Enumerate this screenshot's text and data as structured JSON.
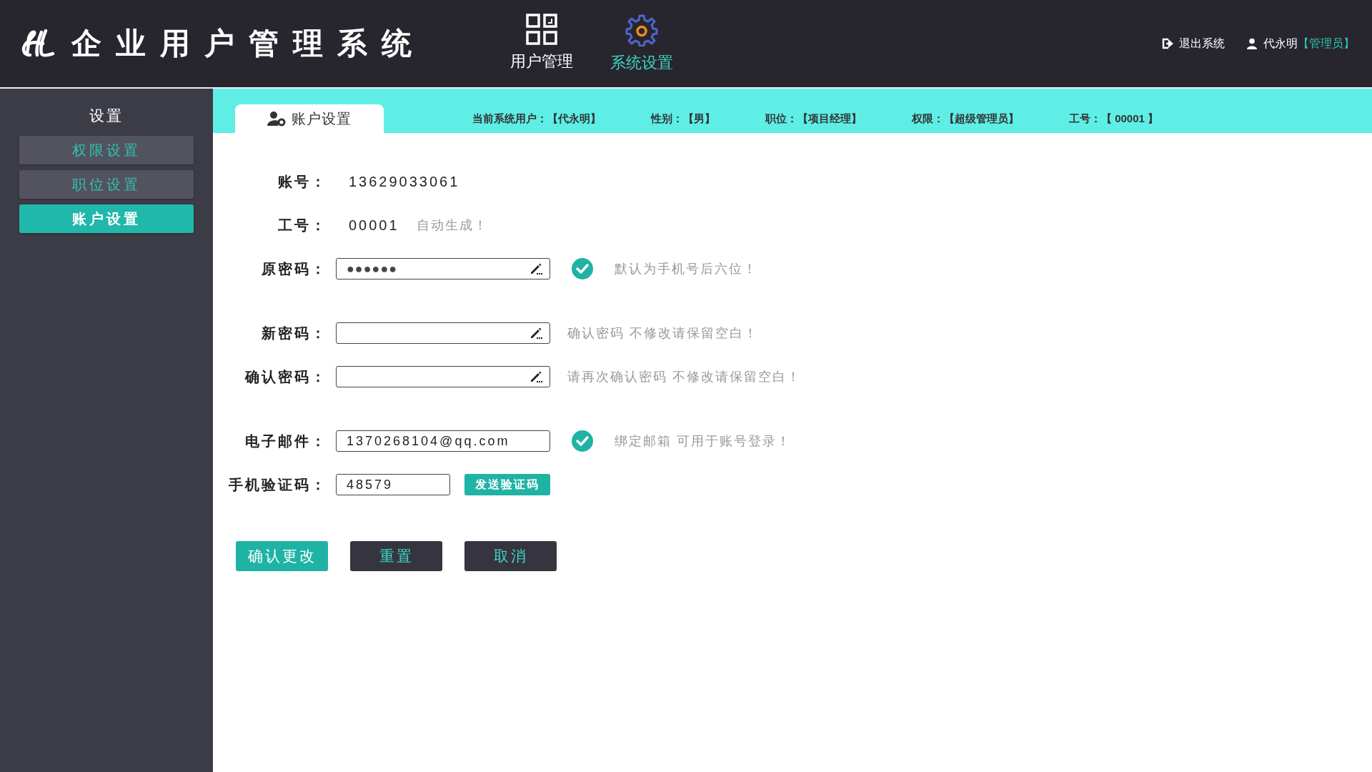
{
  "header": {
    "title": "企业用户管理系统",
    "nav": [
      {
        "label": "用户管理",
        "kind": "grid",
        "selected": false
      },
      {
        "label": "系统设置",
        "kind": "gear",
        "selected": true
      }
    ],
    "logout": "退出系统",
    "user": {
      "name": "代永明",
      "role": "【管理员】"
    }
  },
  "sidebar": {
    "title": "设置",
    "items": [
      {
        "label": "权限设置",
        "selected": false
      },
      {
        "label": "职位设置",
        "selected": false
      },
      {
        "label": "账户设置",
        "selected": true
      }
    ]
  },
  "tab": {
    "label": "账户设置"
  },
  "info": [
    "当前系统用户：【代永明】",
    "性别：【男】",
    "职位：【项目经理】",
    "权限：【超级管理员】",
    "工号：【 00001 】"
  ],
  "form": [
    [
      {
        "kind": "static",
        "label": "账号：",
        "value": "13629033061"
      },
      {
        "kind": "static",
        "label": "工号：",
        "value": "00001",
        "note": "自动生成！"
      },
      {
        "kind": "field",
        "label": "原密码：",
        "value": "●●●●●●",
        "editable": true,
        "valid": true,
        "note": "默认为手机号后六位！"
      }
    ],
    [
      {
        "kind": "field",
        "label": "新密码：",
        "editable": true,
        "valid": false,
        "note": "确认密码 不修改请保留空白！"
      },
      {
        "kind": "field",
        "label": "确认密码：",
        "editable": true,
        "valid": false,
        "note": "请再次确认密码 不修改请保留空白！"
      }
    ],
    [
      {
        "kind": "field",
        "label": "电子邮件：",
        "value": "1370268104@qq.com",
        "editable": false,
        "valid": true,
        "note": "绑定邮箱 可用于账号登录！"
      },
      {
        "kind": "code",
        "label": "手机验证码：",
        "value": "48579",
        "button": "发送验证码"
      }
    ]
  ],
  "buttons": [
    {
      "label": "确认更改",
      "kind": "primary"
    },
    {
      "label": "重置",
      "kind": "secondary"
    },
    {
      "label": "取消",
      "kind": "secondary"
    }
  ]
}
